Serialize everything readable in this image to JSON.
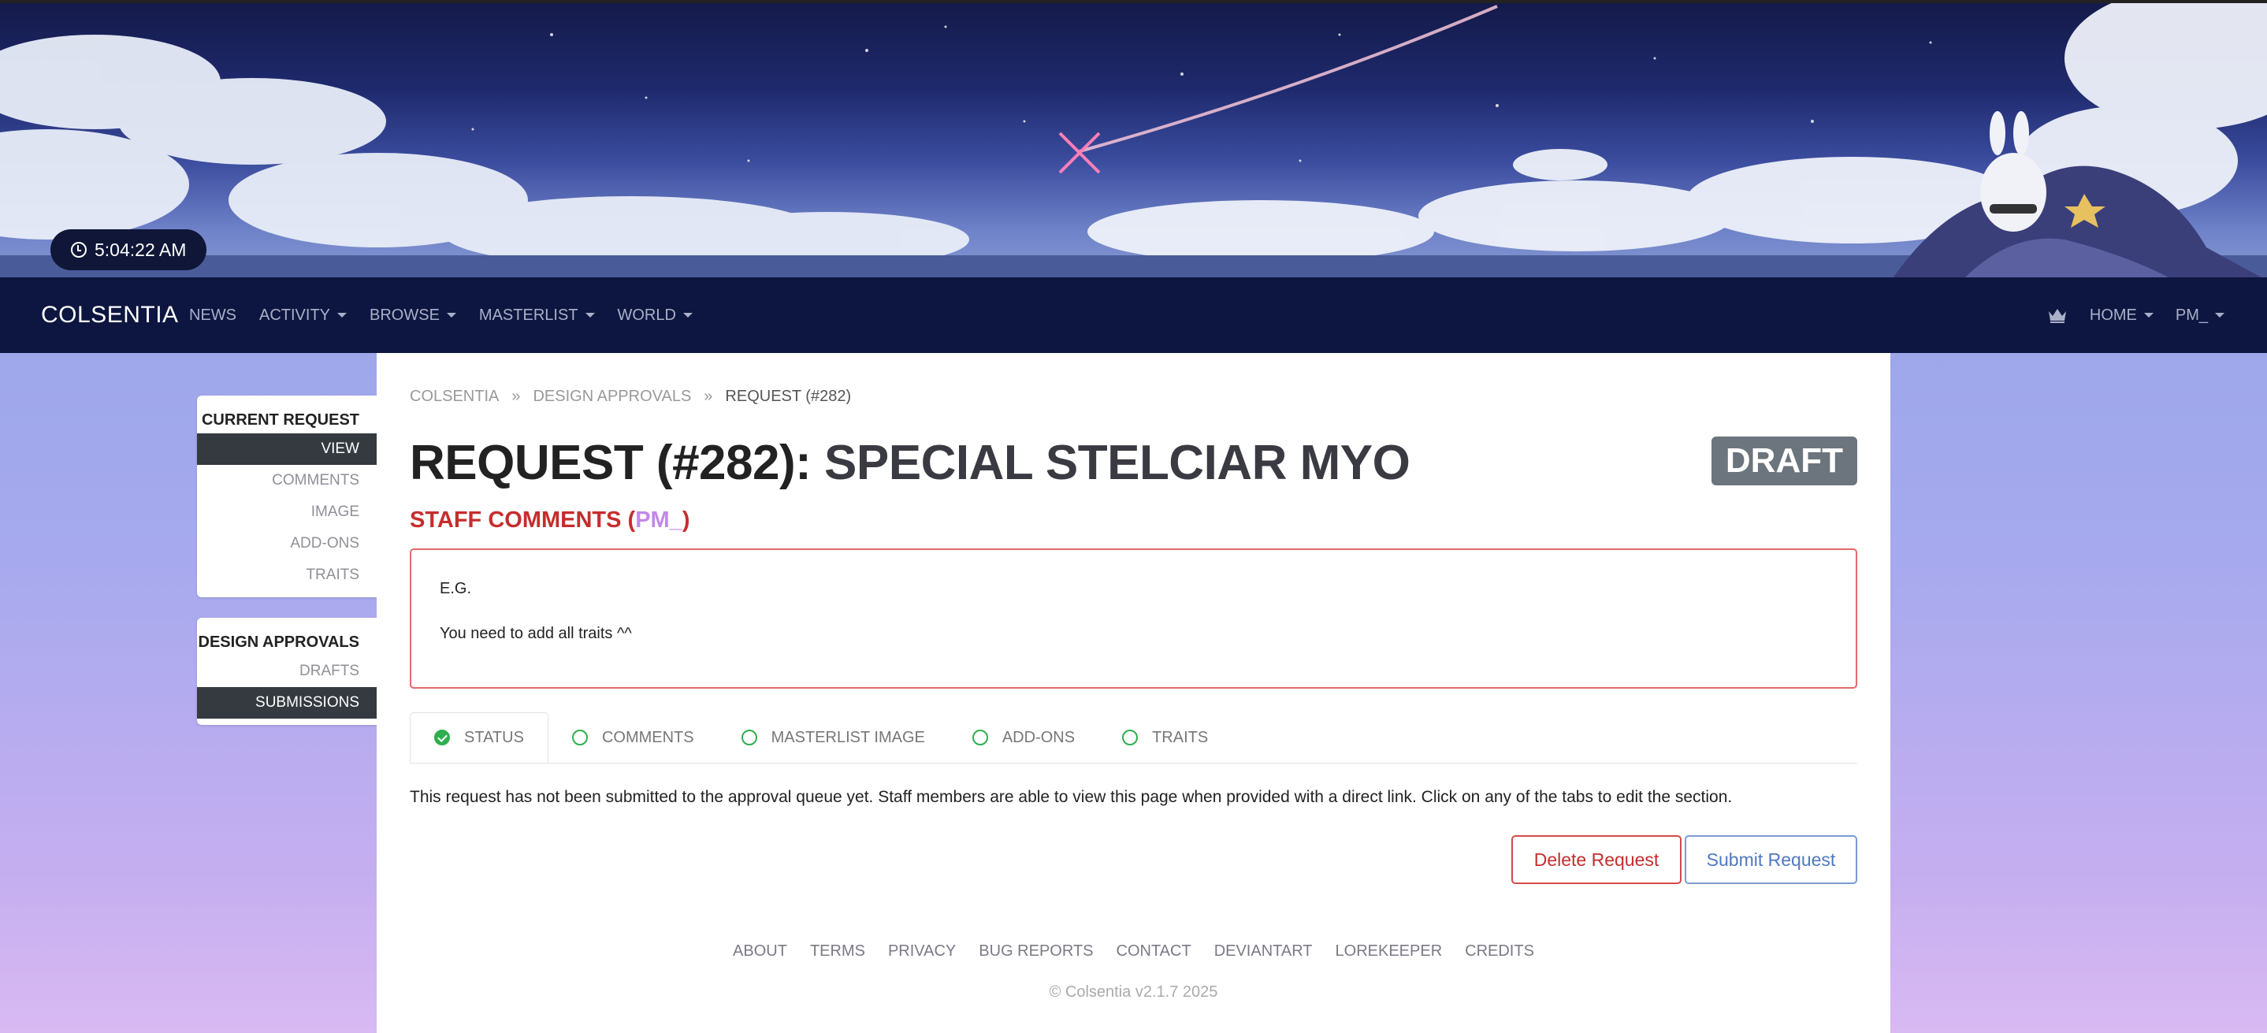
{
  "header": {
    "clock_time": "5:04:22 AM"
  },
  "navbar": {
    "brand": "COLSENTIA",
    "links": [
      {
        "label": "NEWS",
        "dropdown": false
      },
      {
        "label": "ACTIVITY",
        "dropdown": true
      },
      {
        "label": "BROWSE",
        "dropdown": true
      },
      {
        "label": "MASTERLIST",
        "dropdown": true
      },
      {
        "label": "WORLD",
        "dropdown": true
      }
    ],
    "right": {
      "home": "HOME",
      "user": "PM_"
    }
  },
  "sidebar": {
    "current_request": {
      "heading": "CURRENT REQUEST",
      "items": [
        "VIEW",
        "COMMENTS",
        "IMAGE",
        "ADD-ONS",
        "TRAITS"
      ]
    },
    "design_approvals": {
      "heading": "DESIGN APPROVALS",
      "items": [
        "DRAFTS",
        "SUBMISSIONS"
      ]
    }
  },
  "breadcrumb": [
    "COLSENTIA",
    "DESIGN APPROVALS",
    "REQUEST (#282)"
  ],
  "breadcrumb_sep": "»",
  "page": {
    "title": "REQUEST (#282):",
    "subtitle": "SPECIAL STELCIAR MYO",
    "status_badge": "DRAFT"
  },
  "staff_comments": {
    "label": "STAFF COMMENTS (",
    "user": "PM_",
    "label_end": ")",
    "lines": [
      "E.G.",
      "You need to add all traits ^^"
    ]
  },
  "tabs": [
    {
      "label": "STATUS",
      "done": true
    },
    {
      "label": "COMMENTS",
      "done": false
    },
    {
      "label": "MASTERLIST IMAGE",
      "done": false
    },
    {
      "label": "ADD-ONS",
      "done": false
    },
    {
      "label": "TRAITS",
      "done": false
    }
  ],
  "info_text": "This request has not been submitted to the approval queue yet. Staff members are able to view this page when provided with a direct link. Click on any of the tabs to edit the section.",
  "buttons": {
    "delete": "Delete Request",
    "submit": "Submit Request"
  },
  "footer": {
    "links": [
      "ABOUT",
      "TERMS",
      "PRIVACY",
      "BUG REPORTS",
      "CONTACT",
      "DEVIANTART",
      "LOREKEEPER",
      "CREDITS"
    ],
    "copyright": "© Colsentia v2.1.7 2025"
  },
  "colors": {
    "navbar_bg": "#0d1640",
    "danger": "#c62d2d",
    "primary": "#4f78c4",
    "success": "#2fae4e",
    "badge_secondary": "#6c757d",
    "username_accent": "#c389e8"
  }
}
